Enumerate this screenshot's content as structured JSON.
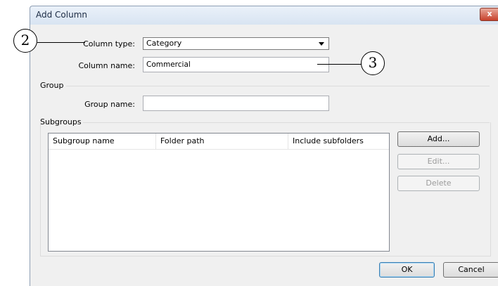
{
  "dialog": {
    "title": "Add Column",
    "close_glyph": "x"
  },
  "form": {
    "column_type_label": "Column type:",
    "column_type_value": "Category",
    "column_name_label": "Column name:",
    "column_name_value": "Commercial"
  },
  "group": {
    "title": "Group",
    "group_name_label": "Group name:",
    "group_name_value": ""
  },
  "subgroups": {
    "title": "Subgroups",
    "columns": [
      "Subgroup name",
      "Folder path",
      "Include subfolders"
    ],
    "rows": []
  },
  "buttons": {
    "add": "Add...",
    "edit": "Edit...",
    "delete": "Delete",
    "ok": "OK",
    "cancel": "Cancel"
  },
  "callouts": {
    "first": "2",
    "second": "3"
  },
  "icons": {
    "dropdown": "chevron-down-icon",
    "close": "close-icon"
  }
}
